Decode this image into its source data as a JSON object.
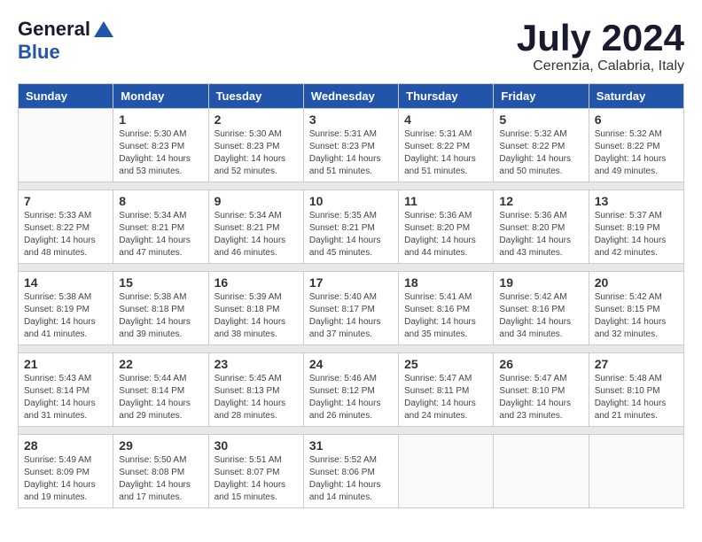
{
  "header": {
    "logo_general": "General",
    "logo_blue": "Blue",
    "month_title": "July 2024",
    "subtitle": "Cerenzia, Calabria, Italy"
  },
  "weekdays": [
    "Sunday",
    "Monday",
    "Tuesday",
    "Wednesday",
    "Thursday",
    "Friday",
    "Saturday"
  ],
  "weeks": [
    [
      {
        "day": "",
        "sunrise": "",
        "sunset": "",
        "daylight": ""
      },
      {
        "day": "1",
        "sunrise": "Sunrise: 5:30 AM",
        "sunset": "Sunset: 8:23 PM",
        "daylight": "Daylight: 14 hours and 53 minutes."
      },
      {
        "day": "2",
        "sunrise": "Sunrise: 5:30 AM",
        "sunset": "Sunset: 8:23 PM",
        "daylight": "Daylight: 14 hours and 52 minutes."
      },
      {
        "day": "3",
        "sunrise": "Sunrise: 5:31 AM",
        "sunset": "Sunset: 8:23 PM",
        "daylight": "Daylight: 14 hours and 51 minutes."
      },
      {
        "day": "4",
        "sunrise": "Sunrise: 5:31 AM",
        "sunset": "Sunset: 8:22 PM",
        "daylight": "Daylight: 14 hours and 51 minutes."
      },
      {
        "day": "5",
        "sunrise": "Sunrise: 5:32 AM",
        "sunset": "Sunset: 8:22 PM",
        "daylight": "Daylight: 14 hours and 50 minutes."
      },
      {
        "day": "6",
        "sunrise": "Sunrise: 5:32 AM",
        "sunset": "Sunset: 8:22 PM",
        "daylight": "Daylight: 14 hours and 49 minutes."
      }
    ],
    [
      {
        "day": "7",
        "sunrise": "Sunrise: 5:33 AM",
        "sunset": "Sunset: 8:22 PM",
        "daylight": "Daylight: 14 hours and 48 minutes."
      },
      {
        "day": "8",
        "sunrise": "Sunrise: 5:34 AM",
        "sunset": "Sunset: 8:21 PM",
        "daylight": "Daylight: 14 hours and 47 minutes."
      },
      {
        "day": "9",
        "sunrise": "Sunrise: 5:34 AM",
        "sunset": "Sunset: 8:21 PM",
        "daylight": "Daylight: 14 hours and 46 minutes."
      },
      {
        "day": "10",
        "sunrise": "Sunrise: 5:35 AM",
        "sunset": "Sunset: 8:21 PM",
        "daylight": "Daylight: 14 hours and 45 minutes."
      },
      {
        "day": "11",
        "sunrise": "Sunrise: 5:36 AM",
        "sunset": "Sunset: 8:20 PM",
        "daylight": "Daylight: 14 hours and 44 minutes."
      },
      {
        "day": "12",
        "sunrise": "Sunrise: 5:36 AM",
        "sunset": "Sunset: 8:20 PM",
        "daylight": "Daylight: 14 hours and 43 minutes."
      },
      {
        "day": "13",
        "sunrise": "Sunrise: 5:37 AM",
        "sunset": "Sunset: 8:19 PM",
        "daylight": "Daylight: 14 hours and 42 minutes."
      }
    ],
    [
      {
        "day": "14",
        "sunrise": "Sunrise: 5:38 AM",
        "sunset": "Sunset: 8:19 PM",
        "daylight": "Daylight: 14 hours and 41 minutes."
      },
      {
        "day": "15",
        "sunrise": "Sunrise: 5:38 AM",
        "sunset": "Sunset: 8:18 PM",
        "daylight": "Daylight: 14 hours and 39 minutes."
      },
      {
        "day": "16",
        "sunrise": "Sunrise: 5:39 AM",
        "sunset": "Sunset: 8:18 PM",
        "daylight": "Daylight: 14 hours and 38 minutes."
      },
      {
        "day": "17",
        "sunrise": "Sunrise: 5:40 AM",
        "sunset": "Sunset: 8:17 PM",
        "daylight": "Daylight: 14 hours and 37 minutes."
      },
      {
        "day": "18",
        "sunrise": "Sunrise: 5:41 AM",
        "sunset": "Sunset: 8:16 PM",
        "daylight": "Daylight: 14 hours and 35 minutes."
      },
      {
        "day": "19",
        "sunrise": "Sunrise: 5:42 AM",
        "sunset": "Sunset: 8:16 PM",
        "daylight": "Daylight: 14 hours and 34 minutes."
      },
      {
        "day": "20",
        "sunrise": "Sunrise: 5:42 AM",
        "sunset": "Sunset: 8:15 PM",
        "daylight": "Daylight: 14 hours and 32 minutes."
      }
    ],
    [
      {
        "day": "21",
        "sunrise": "Sunrise: 5:43 AM",
        "sunset": "Sunset: 8:14 PM",
        "daylight": "Daylight: 14 hours and 31 minutes."
      },
      {
        "day": "22",
        "sunrise": "Sunrise: 5:44 AM",
        "sunset": "Sunset: 8:14 PM",
        "daylight": "Daylight: 14 hours and 29 minutes."
      },
      {
        "day": "23",
        "sunrise": "Sunrise: 5:45 AM",
        "sunset": "Sunset: 8:13 PM",
        "daylight": "Daylight: 14 hours and 28 minutes."
      },
      {
        "day": "24",
        "sunrise": "Sunrise: 5:46 AM",
        "sunset": "Sunset: 8:12 PM",
        "daylight": "Daylight: 14 hours and 26 minutes."
      },
      {
        "day": "25",
        "sunrise": "Sunrise: 5:47 AM",
        "sunset": "Sunset: 8:11 PM",
        "daylight": "Daylight: 14 hours and 24 minutes."
      },
      {
        "day": "26",
        "sunrise": "Sunrise: 5:47 AM",
        "sunset": "Sunset: 8:10 PM",
        "daylight": "Daylight: 14 hours and 23 minutes."
      },
      {
        "day": "27",
        "sunrise": "Sunrise: 5:48 AM",
        "sunset": "Sunset: 8:10 PM",
        "daylight": "Daylight: 14 hours and 21 minutes."
      }
    ],
    [
      {
        "day": "28",
        "sunrise": "Sunrise: 5:49 AM",
        "sunset": "Sunset: 8:09 PM",
        "daylight": "Daylight: 14 hours and 19 minutes."
      },
      {
        "day": "29",
        "sunrise": "Sunrise: 5:50 AM",
        "sunset": "Sunset: 8:08 PM",
        "daylight": "Daylight: 14 hours and 17 minutes."
      },
      {
        "day": "30",
        "sunrise": "Sunrise: 5:51 AM",
        "sunset": "Sunset: 8:07 PM",
        "daylight": "Daylight: 14 hours and 15 minutes."
      },
      {
        "day": "31",
        "sunrise": "Sunrise: 5:52 AM",
        "sunset": "Sunset: 8:06 PM",
        "daylight": "Daylight: 14 hours and 14 minutes."
      },
      {
        "day": "",
        "sunrise": "",
        "sunset": "",
        "daylight": ""
      },
      {
        "day": "",
        "sunrise": "",
        "sunset": "",
        "daylight": ""
      },
      {
        "day": "",
        "sunrise": "",
        "sunset": "",
        "daylight": ""
      }
    ]
  ]
}
